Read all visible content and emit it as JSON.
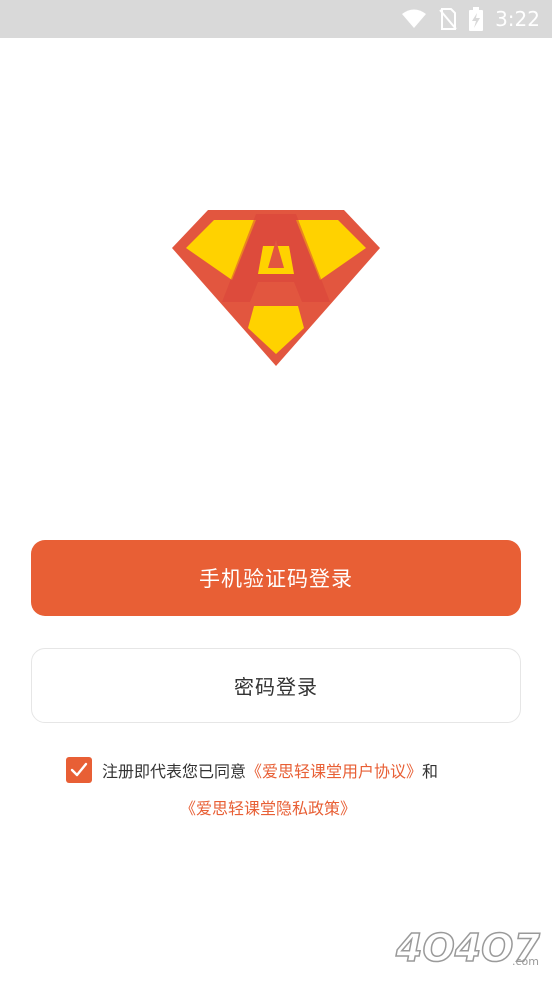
{
  "status_bar": {
    "time": "3:22",
    "icons": [
      "wifi-icon",
      "no-sim-icon",
      "battery-charging-icon"
    ]
  },
  "logo": {
    "letter": "A",
    "icon": "superhero-diamond-logo"
  },
  "buttons": {
    "sms_login": "手机验证码登录",
    "password_login": "密码登录"
  },
  "agreement": {
    "checked": true,
    "prefix": "注册即代表您已同意",
    "user_agreement": "《爱思轻课堂用户协议》",
    "connector": "和",
    "privacy_policy": "《爱思轻课堂隐私政策》"
  },
  "watermark": {
    "text": "4O4O7",
    "suffix": ".com"
  },
  "colors": {
    "accent": "#e85f35",
    "logo_red": "#e2563f",
    "logo_yellow": "#ffd200",
    "status_bar": "#d9d9d9"
  }
}
